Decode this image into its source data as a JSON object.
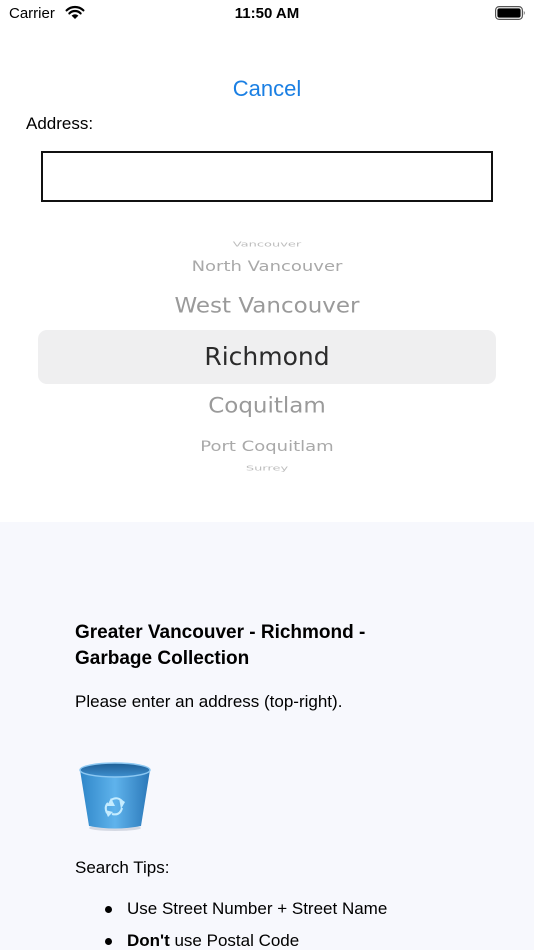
{
  "status_bar": {
    "carrier": "Carrier",
    "time": "11:50 AM"
  },
  "form": {
    "cancel_label": "Cancel",
    "address_label": "Address:",
    "address_value": "",
    "address_placeholder": ""
  },
  "picker": {
    "items": [
      "Vancouver",
      "North Vancouver",
      "West Vancouver",
      "Richmond",
      "Coquitlam",
      "Port Coquitlam",
      "Surrey"
    ],
    "selected": "Richmond"
  },
  "info": {
    "title": "Greater Vancouver - Richmond - Garbage Collection",
    "prompt": "Please enter an address (top-right).",
    "tips_heading": "Search Tips:",
    "tips": [
      {
        "bold": "",
        "text": "Use Street Number + Street Name"
      },
      {
        "bold": "Don't",
        "text": " use Postal Code"
      }
    ]
  },
  "colors": {
    "accent": "#1a7fe3",
    "panel_background": "#f7f8fd",
    "picker_highlight": "#efeff0"
  },
  "icons": {
    "status": [
      "wifi-icon",
      "battery-icon"
    ],
    "content": [
      "recycle-bin-icon"
    ]
  }
}
